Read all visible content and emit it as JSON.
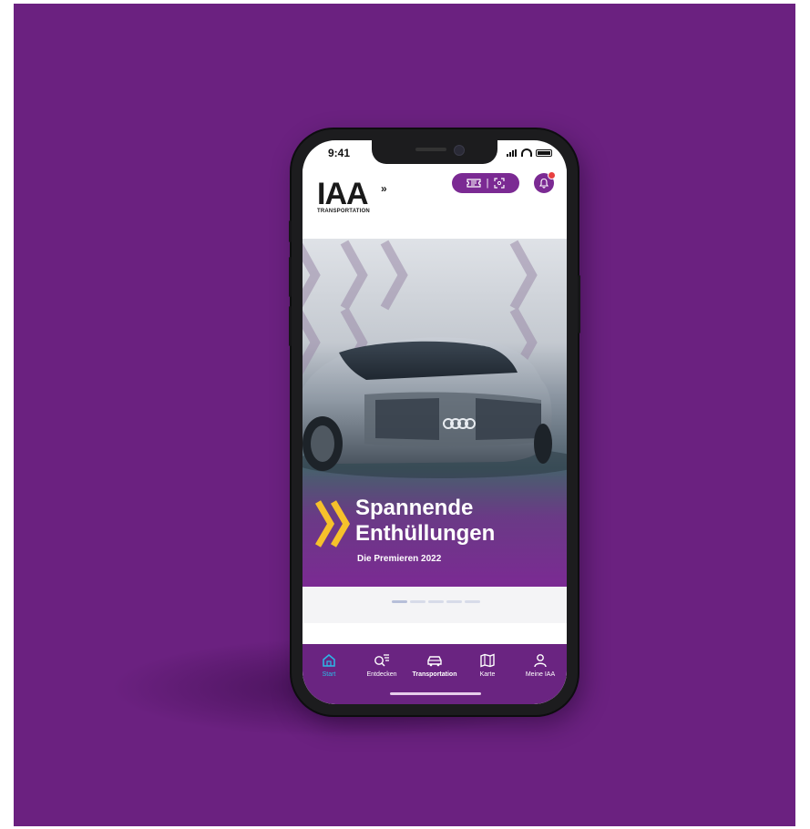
{
  "status_bar": {
    "time": "9:41"
  },
  "header": {
    "logo_text": "IAA",
    "logo_subtitle": "TRANSPORTATION",
    "ticket_icon": "ticket-icon",
    "scan_icon": "scan-icon",
    "bell_icon": "bell-icon",
    "pill_separator": "|",
    "notification_badge_color": "#e84040"
  },
  "hero": {
    "title_line1": "Spannende",
    "title_line2": "Enthüllungen",
    "subtitle": "Die Premieren 2022",
    "arrow_color": "#f6c12b",
    "slides_total": 5,
    "slide_active_index": 0
  },
  "tabbar": {
    "tabs": [
      {
        "label": "Start",
        "icon": "home-icon",
        "active": true
      },
      {
        "label": "Entdecken",
        "icon": "discover-search-icon",
        "active": false
      },
      {
        "label": "Transportation",
        "icon": "truck-icon",
        "active": false
      },
      {
        "label": "Karte",
        "icon": "map-icon",
        "active": false
      },
      {
        "label": "Meine IAA",
        "icon": "person-icon",
        "active": false
      }
    ]
  },
  "colors": {
    "background": "#6b2180",
    "brand_purple": "#7b2a93",
    "active_tab": "#2bb9e8"
  }
}
